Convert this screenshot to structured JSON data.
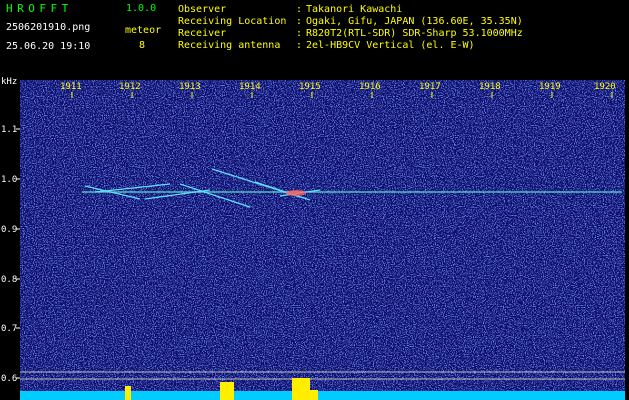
{
  "header": {
    "app_title": "HROFFT",
    "app_version": "1.0.0",
    "filename": "2506201910.png",
    "datetime": "25.06.20 19:10",
    "meteor_label": "meteor",
    "meteor_count": "8"
  },
  "info": [
    {
      "key": "Observer",
      "value": "Takanori Kawachi"
    },
    {
      "key": "Receiving Location",
      "value": "Ogaki, Gifu, JAPAN (136.60E, 35.35N)"
    },
    {
      "key": "Receiver",
      "value": "R820T2(RTL-SDR) SDR-Sharp 53.1000MHz"
    },
    {
      "key": "Receiving antenna",
      "value": "2el-HB9CV Vertical (el. E-W)"
    }
  ],
  "spectrogram": {
    "unit_label": "kHz",
    "hour_labels": [
      "1911",
      "1912",
      "1913",
      "1914",
      "1915",
      "1916",
      "1917",
      "1918",
      "1919",
      "1920"
    ],
    "y_labels": [
      "1.1",
      "1.0",
      "0.9",
      "0.8",
      "0.7",
      "0.6"
    ],
    "colors": {
      "background": "#10106a",
      "noise": "#4040ff",
      "signal": "#60e0ff",
      "text_yellow": "#ffff00",
      "text_green": "#00ff00",
      "bar": "#00ccff",
      "peak": "#ffee00"
    }
  }
}
